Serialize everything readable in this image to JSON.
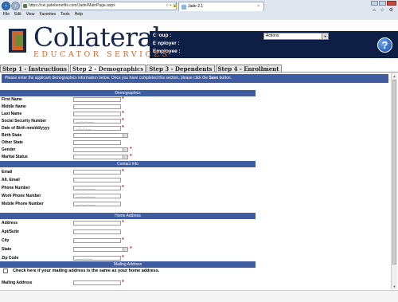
{
  "browser": {
    "url": "https://cei.jadebenefits.com/Jade/MainPage.aspx",
    "address_tools": "⌕ ▾ 🔒 ≣ ↻ ✕",
    "tab_title": "Jade 2.1",
    "tab_close": "×",
    "menu": [
      "File",
      "Edit",
      "View",
      "Favorites",
      "Tools",
      "Help"
    ],
    "toolbar_icons": "⌂ ☆ ⚙"
  },
  "header": {
    "logo_text": "Collateral",
    "logo_subtext": "EDUCATOR SERVICES",
    "group_label": "Group :",
    "employer_label": "Employer :",
    "employee_label": "Employee :",
    "actions_value": "Actions",
    "help_glyph": "?"
  },
  "steps": [
    {
      "label": "Step 1 - Instructions"
    },
    {
      "label": "Step 2 - Demographics"
    },
    {
      "label": "Step 3 - Dependents"
    },
    {
      "label": "Step 4 - Enrollment"
    }
  ],
  "intro": {
    "text": "Please enter the applicant demographics information below. Once you have completed this section, please click the",
    "bold": "Save",
    "suffix": "button."
  },
  "sections": {
    "demographics": "Demographics",
    "contact": "Contact Info",
    "home": "Home Address",
    "mailing": "Mailing Address"
  },
  "fields": {
    "first_name": "First Name",
    "middle_name": "Middle Name",
    "last_name": "Last Name",
    "ssn": "Social Security Number",
    "ssn_mask": "___-__-____",
    "dob": "Date of Birth mm/dd/yyyy",
    "dob_mask": "__/__/____",
    "birth_state": "Birth State",
    "other_state": "Other State",
    "gender": "Gender",
    "marital": "Marital Status",
    "email": "Email",
    "alt_email": "Alt. Email",
    "phone": "Phone Number",
    "phone_mask": "___-___-____",
    "work_phone": "Work Phone Number",
    "work_phone_mask": "___-___-____",
    "mobile_phone": "Mobile Phone Number",
    "mobile_phone_mask": "___-___-____",
    "address": "Address",
    "apt": "Apt/Suite",
    "city": "City",
    "state": "State",
    "zip": "Zip Code",
    "zip_mask": "_____-____",
    "same_address": "Check here if your mailing address is the same as your home address.",
    "mailing_address": "Mailing Address"
  },
  "required_mark": "*",
  "colors": {
    "section_header": "#3e5c9f",
    "header_band": "#0d1f45",
    "logo_navy": "#16294b",
    "logo_orange": "#d0652a",
    "required": "#d21f1f"
  }
}
